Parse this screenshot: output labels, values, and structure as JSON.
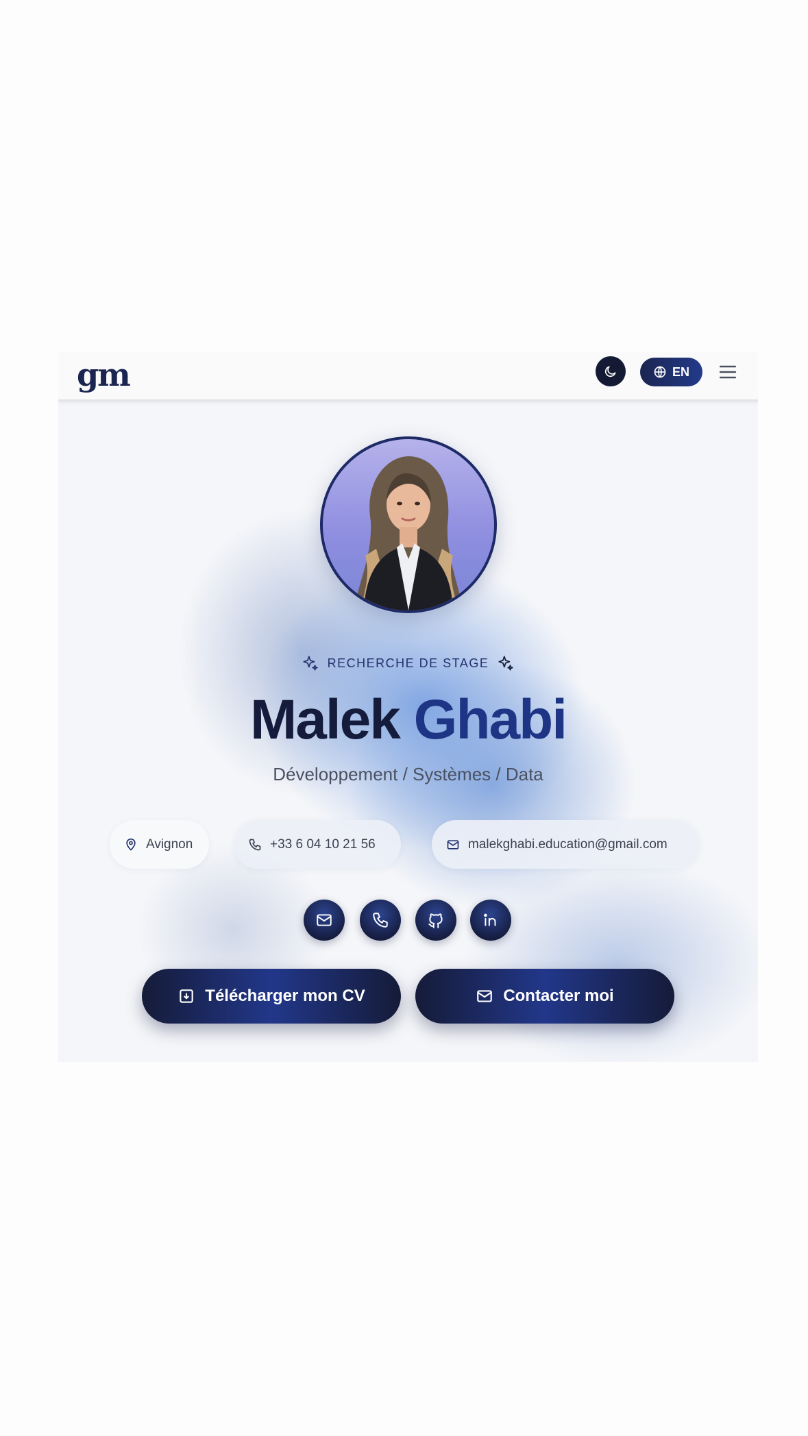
{
  "header": {
    "logo": "gm",
    "language_label": "EN",
    "theme_toggle_icon": "moon-icon",
    "language_icon": "globe-icon",
    "menu_icon": "hamburger-menu-icon"
  },
  "hero": {
    "badge": "RECHERCHE DE STAGE",
    "first_name": "Malek",
    "last_name": "Ghabi",
    "subtitle": "Développement / Systèmes / Data"
  },
  "contacts": {
    "location": "Avignon",
    "phone": "+33 6 04 10 21 56",
    "email": "malekghabi.education@gmail.com"
  },
  "social": [
    "mail-icon",
    "phone-icon",
    "github-icon",
    "linkedin-icon"
  ],
  "actions": {
    "download_cv": "Télécharger mon CV",
    "contact": "Contacter moi"
  },
  "colors": {
    "navy": "#151c3b",
    "accent_blue": "#1e3585",
    "badge_text": "#23316e"
  }
}
